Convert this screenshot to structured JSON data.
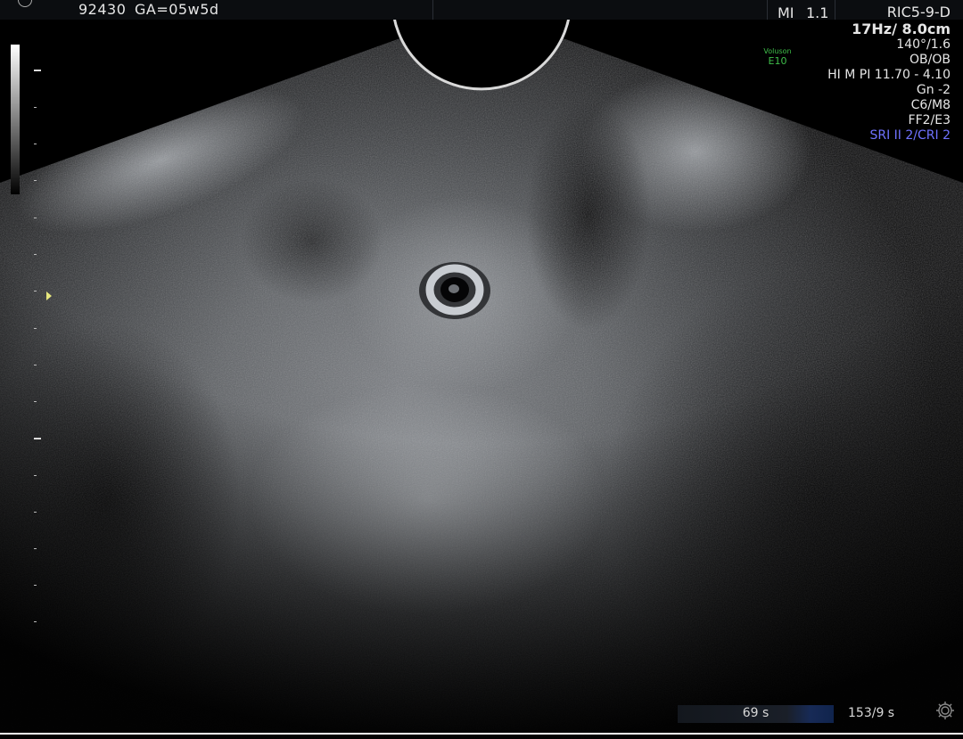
{
  "header": {
    "patient_id": "92430",
    "ga": "GA=05w5d",
    "mi_label": "MI",
    "mi_value": "1.1"
  },
  "params": {
    "probe": "RIC5-9-D",
    "frame_depth": "17Hz/ 8.0cm",
    "angle": "140°/1.6",
    "preset": "OB/OB",
    "harmonic": "HI M PI 11.70 - 4.10",
    "gain": "Gn  -2",
    "map": "C6/M8",
    "filter": "FF2/E3",
    "sri": "SRI II 2/CRI 2"
  },
  "brand": {
    "line1": "Voluson",
    "line2": "E10"
  },
  "cine": {
    "time": "69 s",
    "frames": "153/9 s"
  },
  "icons": {
    "settings": "gear-icon",
    "focus": "focus-marker-icon"
  },
  "colors": {
    "sri_text": "#6f72ff",
    "brand_text": "#3fbf4a",
    "focus_marker": "#e7e77e",
    "cine_progress": "#10244d"
  }
}
